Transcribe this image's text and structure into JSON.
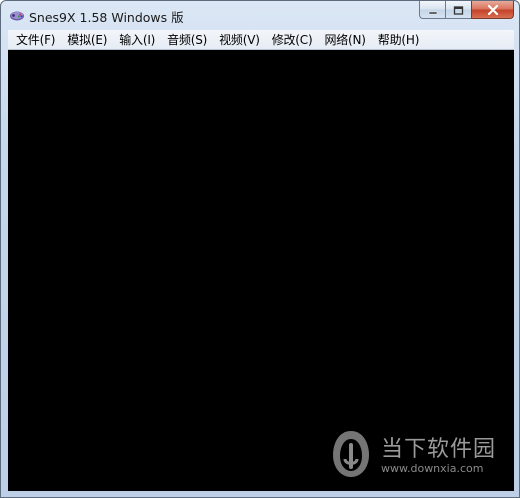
{
  "window": {
    "title": "Snes9X 1.58 Windows 版"
  },
  "menu": {
    "items": [
      {
        "label": "文件(F)"
      },
      {
        "label": "模拟(E)"
      },
      {
        "label": "输入(I)"
      },
      {
        "label": "音频(S)"
      },
      {
        "label": "视频(V)"
      },
      {
        "label": "修改(C)"
      },
      {
        "label": "网络(N)"
      },
      {
        "label": "帮助(H)"
      }
    ]
  },
  "watermark": {
    "name": "当下软件园",
    "url": "www.downxia.com"
  },
  "colors": {
    "viewport": "#000000",
    "titlebar": "#c6d7ec",
    "close_button": "#c4432a"
  },
  "icons": {
    "app": "snes-controller-icon",
    "minimize": "minimize-icon",
    "maximize": "maximize-icon",
    "close": "close-icon"
  }
}
